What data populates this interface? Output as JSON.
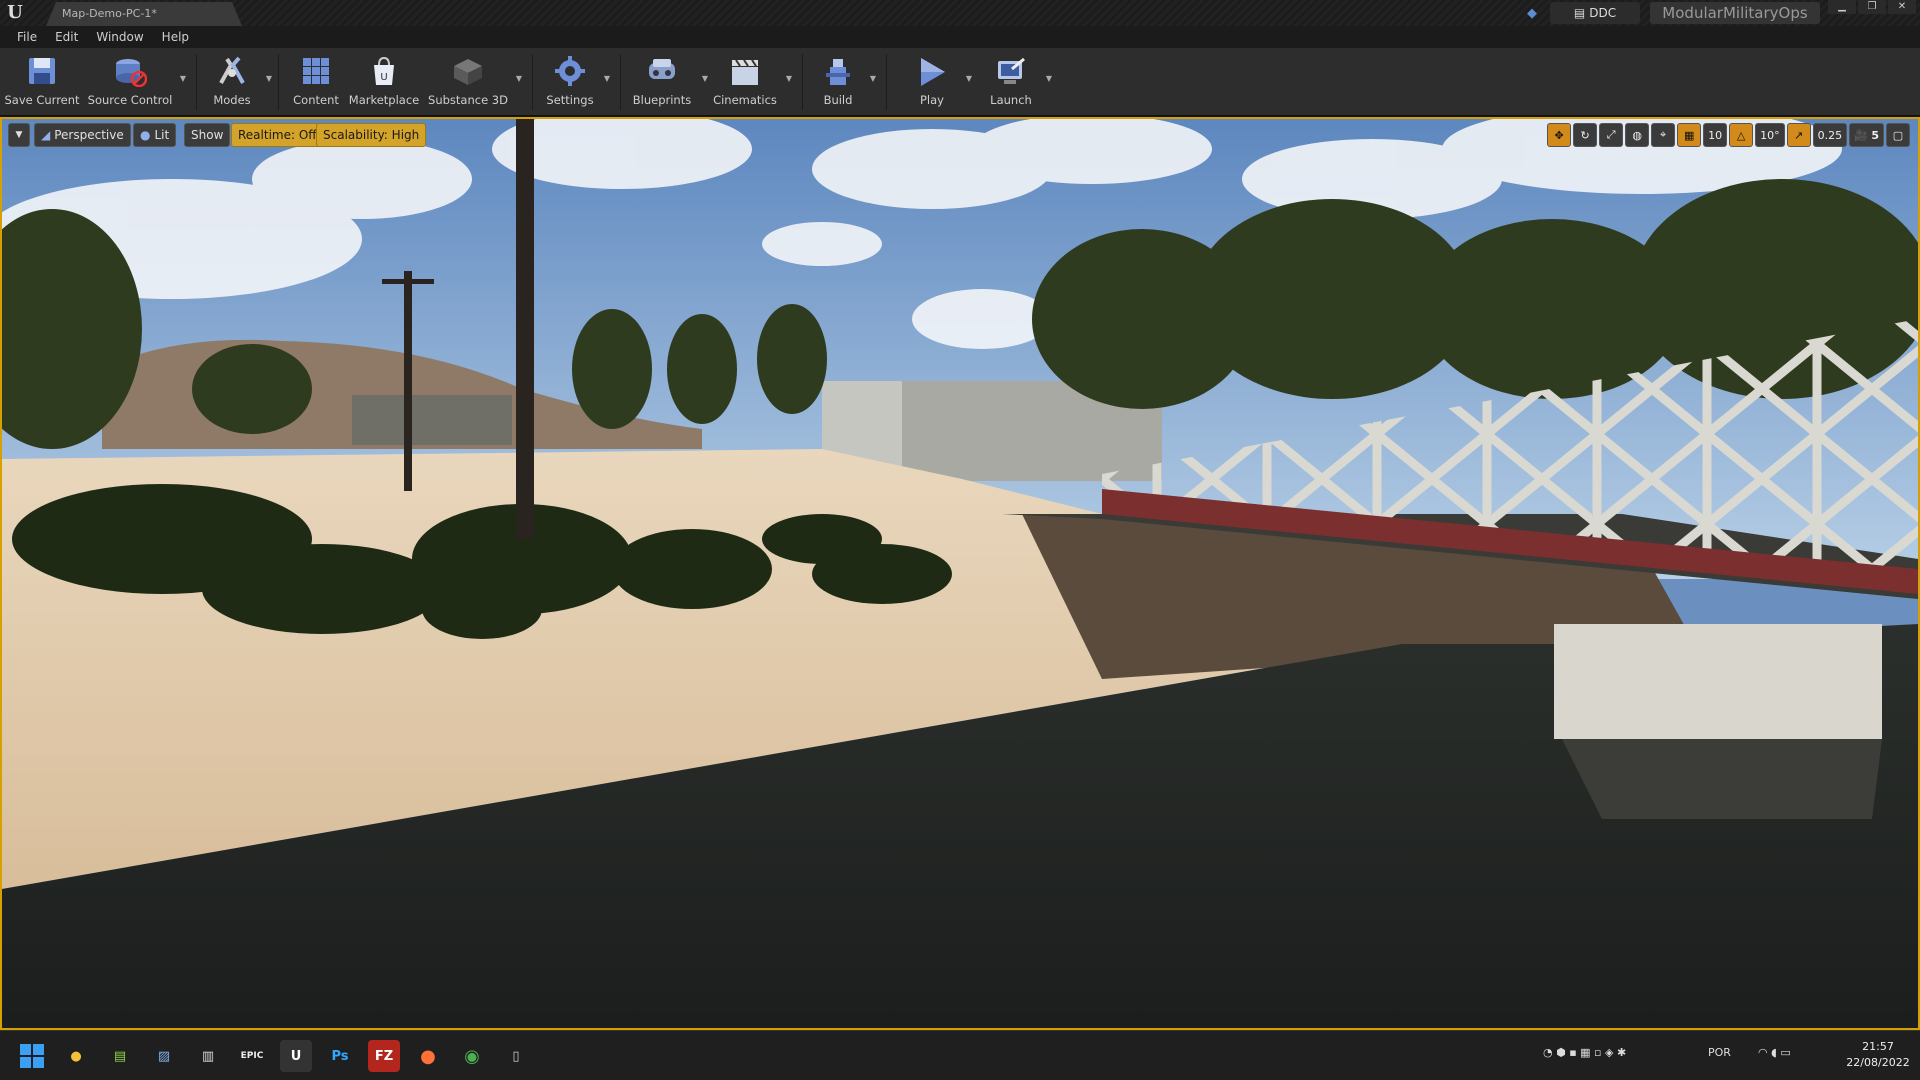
{
  "window": {
    "tab_title": "Map-Demo-PC-1*",
    "ddc_label": "DDC",
    "project_name": "ModularMilitaryOps"
  },
  "menu": [
    "File",
    "Edit",
    "Window",
    "Help"
  ],
  "toolbar": {
    "items": [
      {
        "label": "Save Current",
        "icon": "save-icon"
      },
      {
        "label": "Source Control",
        "icon": "source-control-icon"
      },
      {
        "label": "Modes",
        "icon": "modes-icon"
      },
      {
        "label": "Content",
        "icon": "content-icon"
      },
      {
        "label": "Marketplace",
        "icon": "marketplace-icon"
      },
      {
        "label": "Substance 3D",
        "icon": "substance-icon"
      },
      {
        "label": "Settings",
        "icon": "settings-icon"
      },
      {
        "label": "Blueprints",
        "icon": "blueprints-icon"
      },
      {
        "label": "Cinematics",
        "icon": "cinematics-icon"
      },
      {
        "label": "Build",
        "icon": "build-icon"
      },
      {
        "label": "Play",
        "icon": "play-icon"
      },
      {
        "label": "Launch",
        "icon": "launch-icon"
      }
    ]
  },
  "viewport": {
    "perspective": "Perspective",
    "lit": "Lit",
    "show": "Show",
    "realtime": "Realtime: Off",
    "scalability": "Scalability: High",
    "grid_snap": "10",
    "rotation_snap": "10°",
    "scale_snap": "0.25",
    "camera_speed": "5"
  },
  "taskbar": {
    "apps": [
      "windows-start-icon",
      "explorer-icon",
      "notepad-icon",
      "photos-icon",
      "clapper-icon",
      "epic-games-icon",
      "unreal-engine-icon",
      "photoshop-icon",
      "filezilla-icon",
      "firefox-icon",
      "chrome-icon",
      "app-icon"
    ],
    "epic_label": "EPIC",
    "ps_label": "Ps",
    "fz_label": "FZ",
    "language": "POR",
    "time": "21:57",
    "date": "22/08/2022"
  },
  "colors": {
    "accent": "#d6a000",
    "realtime_bg": "#d4a32a"
  }
}
